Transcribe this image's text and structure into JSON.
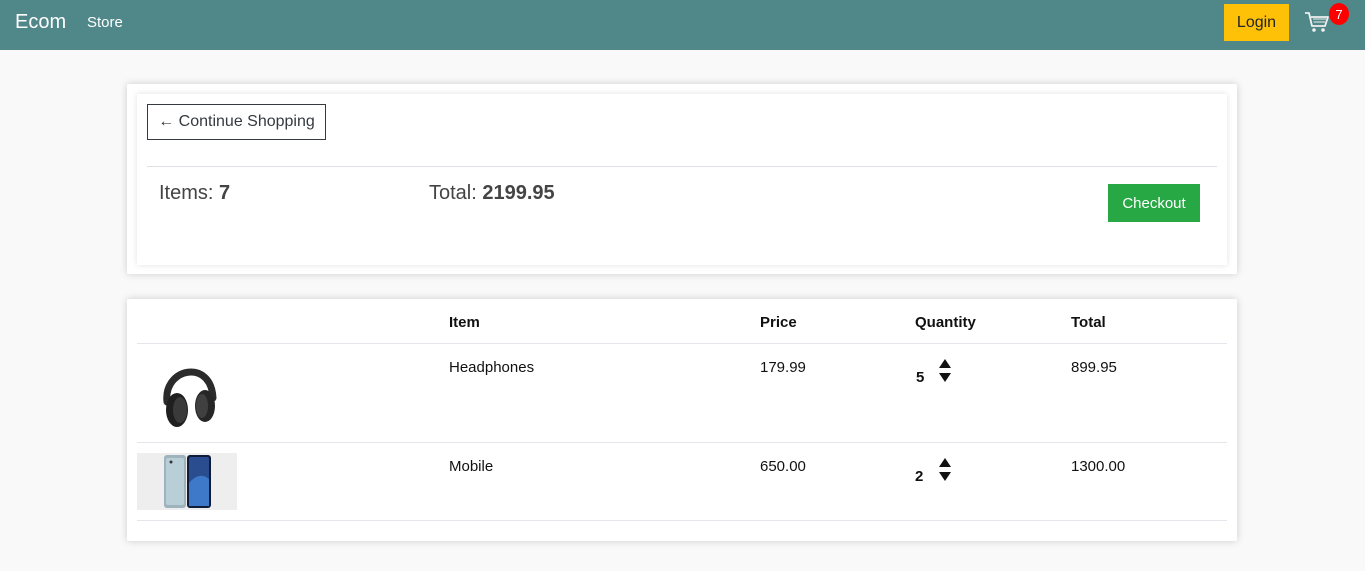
{
  "navbar": {
    "brand": "Ecom",
    "link_store": "Store",
    "login_label": "Login",
    "cart_count": "7",
    "bg_color": "#508789"
  },
  "summary": {
    "continue_label": "← Continue Shopping",
    "items_label": "Items: ",
    "items_value": "7",
    "total_label": "Total: ",
    "total_value": "2199.95",
    "checkout_label": "Checkout"
  },
  "table": {
    "headers": [
      "Item",
      "Price",
      "Quantity",
      "Total"
    ],
    "rows": [
      {
        "image": "headphones-image",
        "item": "Headphones",
        "price": "179.99",
        "quantity": "5",
        "total": "899.95"
      },
      {
        "image": "mobile-image",
        "item": "Mobile",
        "price": "650.00",
        "quantity": "2",
        "total": "1300.00"
      }
    ]
  }
}
